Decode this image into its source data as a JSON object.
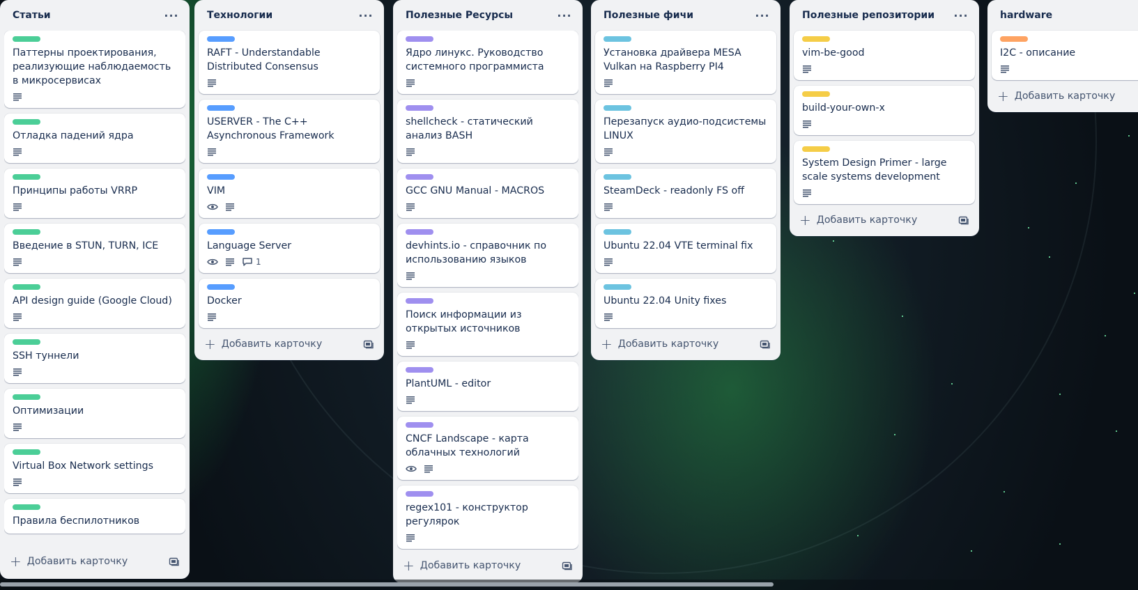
{
  "lists": [
    {
      "title": "Статьи",
      "add_label": "Добавить карточку",
      "cards": [
        {
          "title": "Паттерны проектирования, реализующие наблюдаемость в микросервисах",
          "label_color": "#4bce97",
          "badges": [
            "description"
          ]
        },
        {
          "title": "Отладка падений ядра",
          "label_color": "#4bce97",
          "badges": [
            "description"
          ]
        },
        {
          "title": "Принципы работы VRRP",
          "label_color": "#4bce97",
          "badges": [
            "description"
          ]
        },
        {
          "title": "Введение в STUN, TURN, ICE",
          "label_color": "#4bce97",
          "badges": [
            "description"
          ]
        },
        {
          "title": "API design guide (Google Cloud)",
          "label_color": "#4bce97",
          "badges": [
            "description"
          ]
        },
        {
          "title": "SSH туннели",
          "label_color": "#4bce97",
          "badges": [
            "description"
          ]
        },
        {
          "title": "Оптимизации",
          "label_color": "#4bce97",
          "badges": [
            "description"
          ]
        },
        {
          "title": "Virtual Box Network settings",
          "label_color": "#4bce97",
          "badges": [
            "description"
          ]
        },
        {
          "title": "Правила беспилотников",
          "label_color": "#4bce97",
          "badges": []
        }
      ]
    },
    {
      "title": "Технологии",
      "add_label": "Добавить карточку",
      "cards": [
        {
          "title": "RAFT - Understandable Distributed Consensus",
          "label_color": "#579dff",
          "badges": [
            "description"
          ]
        },
        {
          "title": "USERVER - The C++ Asynchronous Framework",
          "label_color": "#579dff",
          "badges": [
            "description"
          ]
        },
        {
          "title": "VIM",
          "label_color": "#579dff",
          "badges": [
            "watch",
            "description"
          ]
        },
        {
          "title": "Language Server",
          "label_color": "#579dff",
          "badges": [
            "watch",
            "description",
            "comments"
          ],
          "comments": "1"
        },
        {
          "title": "Docker",
          "label_color": "#579dff",
          "badges": [
            "description"
          ]
        }
      ]
    },
    {
      "title": "Полезные Ресурсы",
      "add_label": "Добавить карточку",
      "cards": [
        {
          "title": "Ядро линукс. Руководство системного программиста",
          "label_color": "#9f8fef",
          "badges": [
            "description"
          ]
        },
        {
          "title": "shellcheck - статический анализ BASH",
          "label_color": "#9f8fef",
          "badges": [
            "description"
          ]
        },
        {
          "title": "GCC GNU Manual - MACROS",
          "label_color": "#9f8fef",
          "badges": [
            "description"
          ]
        },
        {
          "title": "devhints.io - справочник по использованию языков",
          "label_color": "#9f8fef",
          "badges": [
            "description"
          ]
        },
        {
          "title": "Поиск информации из открытых источников",
          "label_color": "#9f8fef",
          "badges": [
            "description"
          ]
        },
        {
          "title": "PlantUML - editor",
          "label_color": "#9f8fef",
          "badges": [
            "description"
          ]
        },
        {
          "title": "CNCF Landscape - карта облачных технологий",
          "label_color": "#9f8fef",
          "badges": [
            "watch",
            "description"
          ]
        },
        {
          "title": "regex101 - конструктор регулярок",
          "label_color": "#9f8fef",
          "badges": [
            "description"
          ]
        }
      ]
    },
    {
      "title": "Полезные фичи",
      "add_label": "Добавить карточку",
      "cards": [
        {
          "title": "Установка драйвера MESA Vulkan на Raspberry PI4",
          "label_color": "#6cc3e0",
          "badges": [
            "description"
          ]
        },
        {
          "title": "Перезапуск аудио-подсистемы LINUX",
          "label_color": "#6cc3e0",
          "badges": [
            "description"
          ]
        },
        {
          "title": "SteamDeck - readonly FS off",
          "label_color": "#6cc3e0",
          "badges": [
            "description"
          ]
        },
        {
          "title": "Ubuntu 22.04 VTE terminal fix",
          "label_color": "#6cc3e0",
          "badges": [
            "description"
          ]
        },
        {
          "title": "Ubuntu 22.04 Unity fixes",
          "label_color": "#6cc3e0",
          "badges": [
            "description"
          ]
        }
      ]
    },
    {
      "title": "Полезные репозитории",
      "add_label": "Добавить карточку",
      "cards": [
        {
          "title": "vim-be-good",
          "label_color": "#f5cd47",
          "badges": [
            "description"
          ]
        },
        {
          "title": "build-your-own-x",
          "label_color": "#f5cd47",
          "badges": [
            "description"
          ]
        },
        {
          "title": "System Design Primer - large scale systems development",
          "label_color": "#f5cd47",
          "badges": [
            "description"
          ]
        }
      ]
    },
    {
      "title": "hardware",
      "add_label": "Добавить карточку",
      "cards": [
        {
          "title": "I2C - описание",
          "label_color": "#fea362",
          "badges": [
            "description"
          ]
        }
      ]
    }
  ]
}
